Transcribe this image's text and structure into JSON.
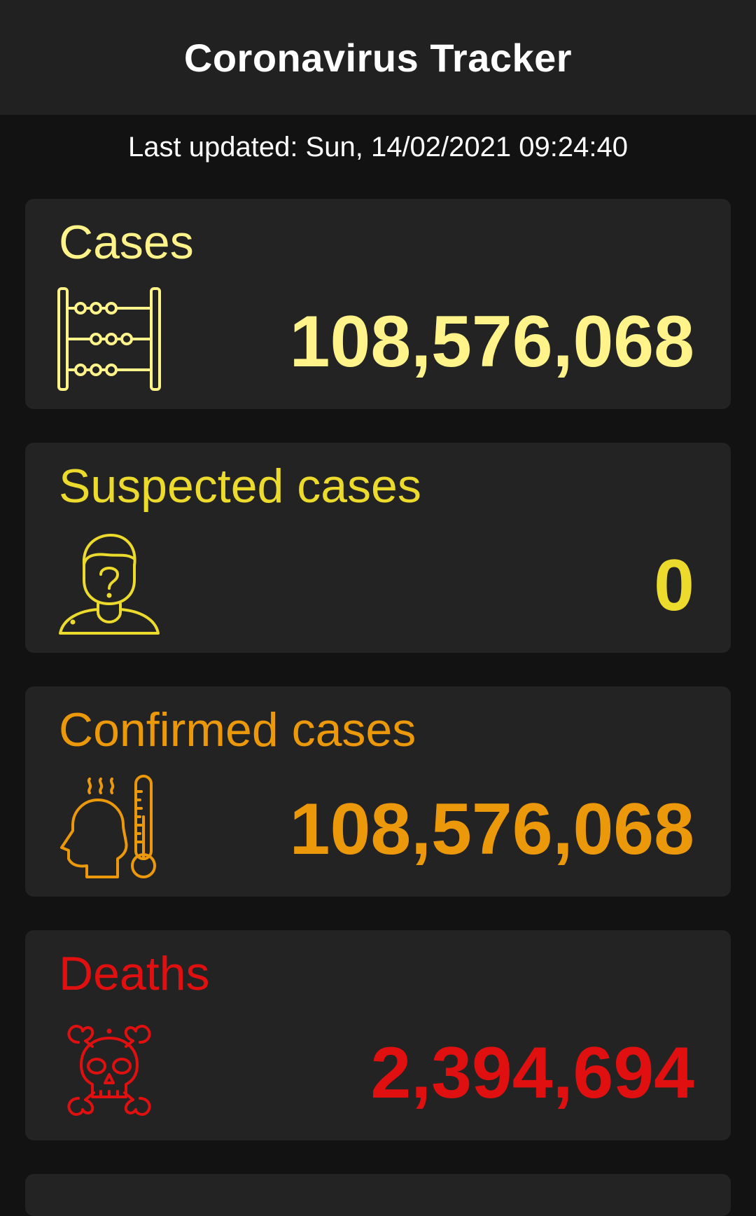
{
  "app_bar": {
    "title": "Coronavirus Tracker"
  },
  "last_updated": "Last updated: Sun, 14/02/2021 09:24:40",
  "colors": {
    "cases": "#fff389",
    "suspected": "#ecda2c",
    "confirmed": "#eb980b",
    "deaths": "#e01010"
  },
  "cards": {
    "cases": {
      "title": "Cases",
      "value": "108,576,068",
      "icon": "abacus-icon"
    },
    "suspected": {
      "title": "Suspected cases",
      "value": "0",
      "icon": "question-person-icon"
    },
    "confirmed": {
      "title": "Confirmed cases",
      "value": "108,576,068",
      "icon": "fever-thermometer-icon"
    },
    "deaths": {
      "title": "Deaths",
      "value": "2,394,694",
      "icon": "skull-crossbones-icon"
    }
  }
}
